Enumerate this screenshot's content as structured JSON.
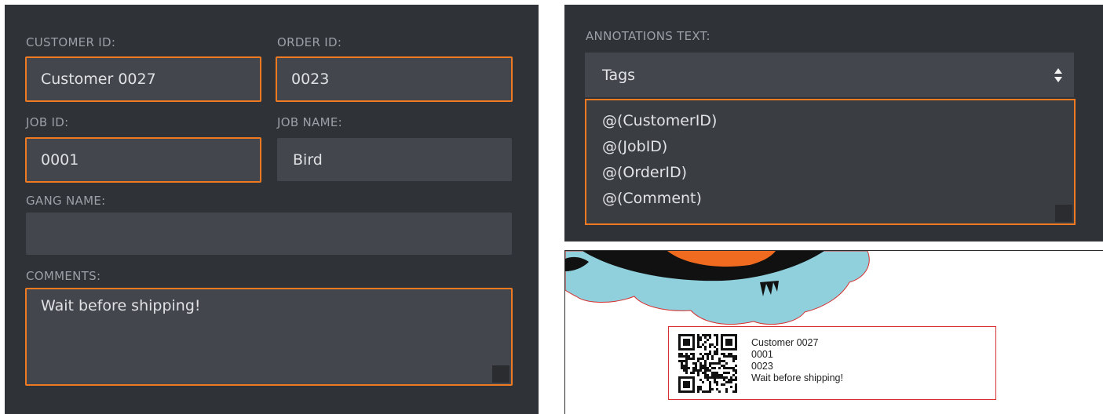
{
  "form": {
    "customer_id": {
      "label": "CUSTOMER ID:",
      "value": "Customer 0027"
    },
    "order_id": {
      "label": "ORDER ID:",
      "value": "0023"
    },
    "job_id": {
      "label": "JOB ID:",
      "value": "0001"
    },
    "job_name": {
      "label": "JOB NAME:",
      "value": "Bird"
    },
    "gang_name": {
      "label": "GANG NAME:",
      "value": ""
    },
    "comments": {
      "label": "COMMENTS:",
      "value": "Wait before shipping!"
    }
  },
  "annotations": {
    "label": "ANNOTATIONS TEXT:",
    "select_value": "Tags",
    "lines": [
      "@(CustomerID)",
      "@(JobID)",
      "@(OrderID)",
      "@(Comment)"
    ]
  },
  "preview": {
    "lines": [
      "Customer 0027",
      "0001",
      "0023",
      "Wait before shipping!"
    ]
  },
  "colors": {
    "panel_bg": "#2f3237",
    "field_bg": "#43464c",
    "highlight": "#f07a22",
    "cut_line": "#d83030",
    "shape_fill": "#8fd0dc"
  }
}
